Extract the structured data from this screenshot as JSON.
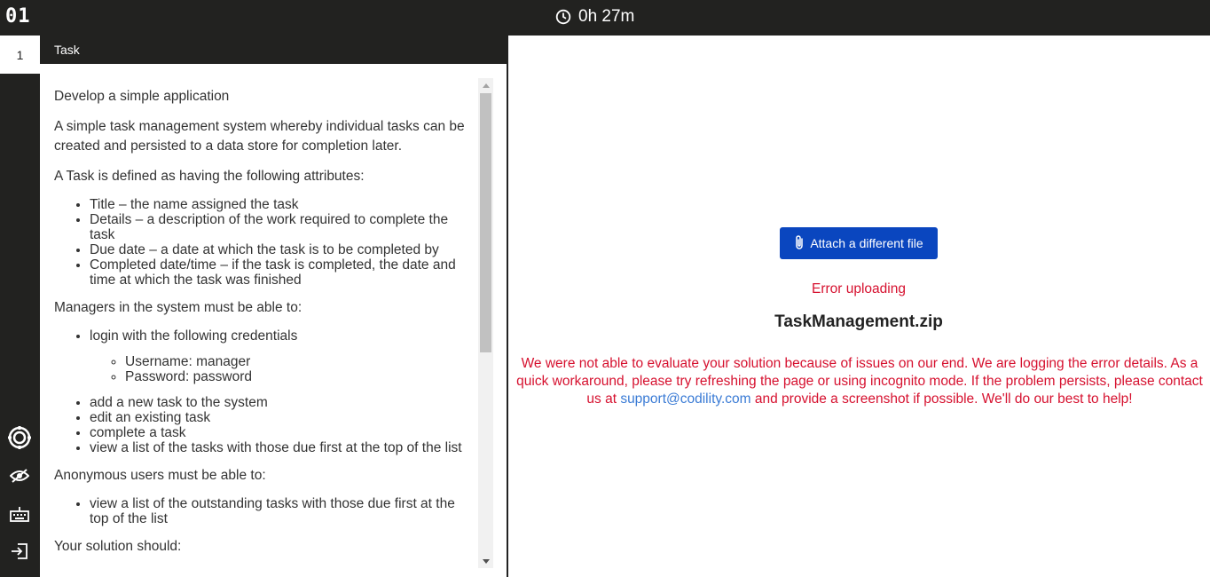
{
  "topbar": {
    "logo": "01",
    "timer": "0h 27m"
  },
  "sidebar": {
    "tab_number": "1",
    "icons": [
      "settings-icon",
      "hide-icon",
      "keyboard-icon",
      "exit-icon"
    ]
  },
  "task": {
    "header": "Task",
    "intro": "Develop a simple application",
    "description": "A simple task management system whereby individual tasks can be created and persisted to a data store for completion later.",
    "attributes_intro": "A Task is defined as having the following attributes:",
    "attributes": [
      "Title – the name assigned the task",
      "Details – a description of the work required to complete the task",
      "Due date – a date at which the task is to be completed by",
      "Completed date/time – if the task is completed, the date and time at which the task was finished"
    ],
    "managers_intro": "Managers in the system must be able to:",
    "manager_login": "login with the following credentials",
    "credentials": [
      "Username: manager",
      "Password: password"
    ],
    "manager_actions": [
      "add a new task to the system",
      "edit an existing task",
      "complete a task",
      "view a list of the tasks with those due first at the top of the list"
    ],
    "anonymous_intro": "Anonymous users must be able to:",
    "anonymous_actions": [
      "view a list of the outstanding tasks with those due first at the top of the list"
    ],
    "solution_intro": "Your solution should:"
  },
  "upload": {
    "attach_button": "Attach a different file",
    "error_title": "Error uploading",
    "filename": "TaskManagement.zip",
    "message_before": "We were not able to evaluate your solution because of issues on our end. We are logging the error details. As a quick workaround, please try refreshing the page or using incognito mode. If the problem persists, please contact us at ",
    "support_email": "support@codility.com",
    "message_after": " and provide a screenshot if possible. We'll do our best to help!",
    "accent_color": "#0a46bf",
    "error_color": "#d6112f"
  }
}
